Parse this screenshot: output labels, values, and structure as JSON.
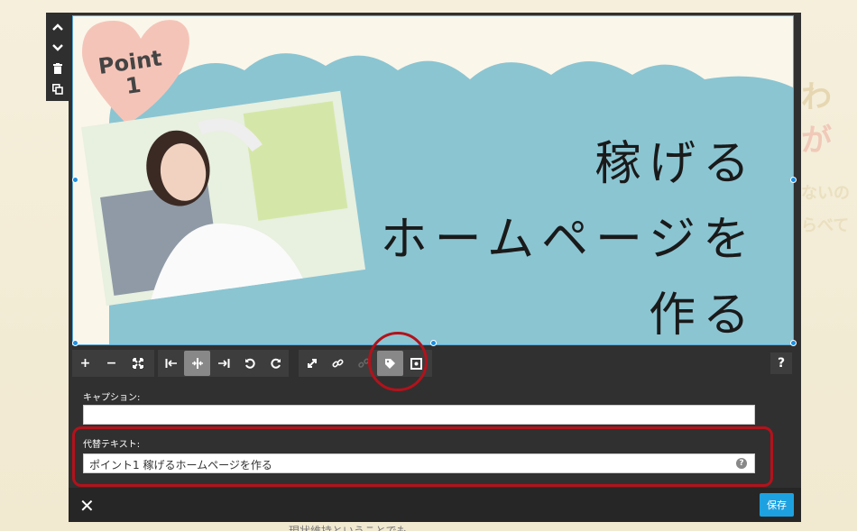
{
  "background": {
    "right_text_1": "わ",
    "right_text_2": "が",
    "right_text_3": "ないの",
    "right_text_4": "らべて",
    "bottom_text": "現状維持ということでも"
  },
  "side_toolbar": {
    "up": "⌃",
    "down": "⌄",
    "delete": "🗑",
    "duplicate": "⧉"
  },
  "image": {
    "badge_line1": "Point",
    "badge_line2": "1",
    "headline_line1": "稼げる",
    "headline_line2": "ホームページを",
    "headline_line3": "作る"
  },
  "toolbar": {
    "zoom_in": "+",
    "zoom_out": "−",
    "fit": "⤢",
    "align_left": "|←",
    "align_center": "·|·",
    "align_right": "→|",
    "undo": "↶",
    "redo": "↷",
    "expand": "⤢",
    "link": "🔗",
    "unlink": "⛓",
    "tag": "🏷",
    "crop": "▣",
    "help": "?"
  },
  "caption": {
    "label": "キャプション:",
    "value": ""
  },
  "alt_text": {
    "label": "代替テキスト:",
    "value": "ポイント1 稼げるホームページを作る",
    "help": "?"
  },
  "footer": {
    "close": "✕",
    "save": "保存"
  }
}
